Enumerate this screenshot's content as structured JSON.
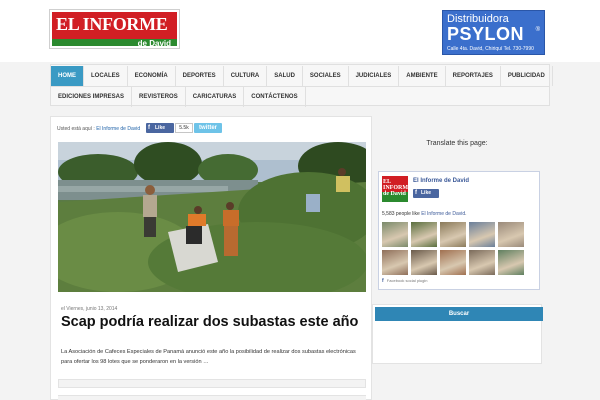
{
  "header": {
    "logo_line1": "EL INFORME",
    "logo_line2": "de David",
    "ad_brand_top": "Distribuidora",
    "ad_brand_main": "PSYLON",
    "ad_reg": "®",
    "ad_address": "Calle 4ta. David, Chiriquí   Tel. 730-7990"
  },
  "nav": {
    "row1": [
      "HOME",
      "LOCALES",
      "ECONOMÍA",
      "DEPORTES",
      "CULTURA",
      "SALUD",
      "SOCIALES",
      "JUDICIALES",
      "AMBIENTE",
      "REPORTAJES",
      "PUBLICIDAD"
    ],
    "row2": [
      "EDICIONES IMPRESAS",
      "REVISTEROS",
      "CARICATURAS",
      "CONTÁCTENOS"
    ],
    "active_index": 0
  },
  "breadcrumbs": {
    "prefix": "Usted está aquí :",
    "link": "El Informe de David"
  },
  "social": {
    "like_label": "Like",
    "like_count": "5.5k",
    "twitter_label": "twitter"
  },
  "article": {
    "meta": "el Viernes, junio 13, 2014",
    "title": "Scap podría realizar dos subastas este año",
    "excerpt": "La Asociación de Cafeces Especiales de Panamá anunció este año la posibilidad de realizar dos subastas electrónicas para ofertar los 98 lotes que se ponderaron en la versión …"
  },
  "sidebar": {
    "translate_title": "Translate this page:",
    "fb_logo_text": "EL INFORME de David",
    "fb_page_name": "El Informe de David",
    "fb_like_label": "Like",
    "fb_people_count": "5,583 people like",
    "fb_people_link": "El Informe de David",
    "fb_plugin_label": "Facebook social plugin",
    "search_button": "Buscar"
  },
  "colors": {
    "nav_active": "#3a9ac4",
    "link": "#1d61a8",
    "facebook": "#3b5998",
    "search_button": "#2f86b5",
    "logo_red": "#d11e24",
    "logo_green": "#2b8a2f"
  }
}
